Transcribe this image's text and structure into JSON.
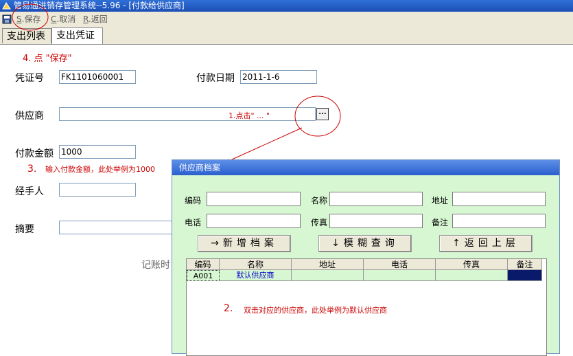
{
  "window": {
    "title": "管易通进销存管理系统--5.96 - [付款给供应商]"
  },
  "toolbar": {
    "save_key": "S",
    "save_label": ".保存",
    "cancel_key": "C",
    "cancel_label": ".取消",
    "back_key": "R",
    "back_label": ".返回"
  },
  "tabs": [
    {
      "label": "支出列表"
    },
    {
      "label": "支出凭证"
    }
  ],
  "form": {
    "voucher_label": "凭证号",
    "voucher_value": "FK1101060001",
    "date_label": "付款日期",
    "date_value": "2011-1-6",
    "supplier_label": "供应商",
    "supplier_value": "",
    "supplier_button": "...",
    "amount_label": "付款金额",
    "amount_value": "1000",
    "handler_label": "经手人",
    "handler_value": "",
    "memo_label": "摘要",
    "memo_value": "",
    "partial_label": "记账时"
  },
  "annotations": {
    "step1": "1.点击\" ... \"",
    "step2_num": "2.",
    "step2_text": "双击对应的供应商，此处举例为默认供应商",
    "step3_num": "3.",
    "step3_text": "输入付款金额，此处举例为1000",
    "step4": "4. 点 \"保存\""
  },
  "dialog": {
    "title": "供应商档案",
    "labels": {
      "code": "编码",
      "name": "名称",
      "address": "地址",
      "phone": "电话",
      "fax": "传真",
      "note": "备注"
    },
    "buttons": {
      "add": "→新增档案",
      "fuzzy": "↓模糊查询",
      "back": "↑返回上层"
    },
    "grid": {
      "headers": [
        "编码",
        "名称",
        "地址",
        "电话",
        "传真",
        "备注"
      ],
      "rows": [
        [
          "A001",
          "默认供应商",
          "",
          "",
          "",
          ""
        ]
      ]
    }
  },
  "colors": {
    "title_bar": "#2f6fd6",
    "dialog_bg": "#d7f6d2",
    "annotation_red": "#cc0000"
  }
}
